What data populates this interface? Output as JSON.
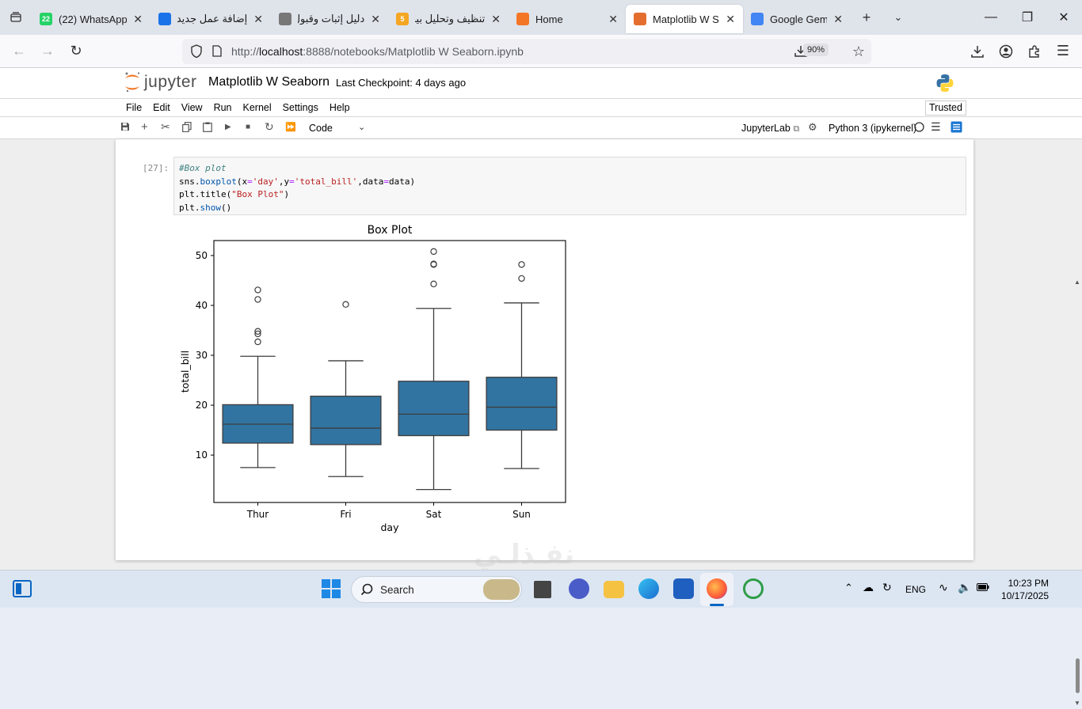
{
  "browser": {
    "tabs": [
      {
        "title": "(22) WhatsApp",
        "badge": "22",
        "icon": "whatsapp-icon",
        "color": "#25d366"
      },
      {
        "title": "إضافة عمل جديد |",
        "icon": "refresh-swirl-icon",
        "color": "#1a73e8"
      },
      {
        "title": "دليل إثبات وقبول المها",
        "icon": "generic-page-icon",
        "color": "#777777"
      },
      {
        "title": "تنظيف وتحليل بيا",
        "icon": "five-icon",
        "badge": "5",
        "color": "#f5a623"
      },
      {
        "title": "Home",
        "icon": "jupyter-spinner-icon",
        "color": "#f37626"
      },
      {
        "title": "Matplotlib W Seaborn",
        "icon": "notebook-icon",
        "color": "#e46e2e",
        "active": true
      },
      {
        "title": "Google Gemini",
        "icon": "gemini-icon",
        "color": "#4285f4"
      }
    ],
    "url_prefix": "http://",
    "url_host": "localhost",
    "url_rest": ":8888/notebooks/Matplotlib W Seaborn.ipynb",
    "zoom": "90%"
  },
  "jupyter": {
    "logo_text": "jupyter",
    "notebook_title": "Matplotlib W Seaborn",
    "checkpoint": "Last Checkpoint: 4 days ago",
    "menu": [
      "File",
      "Edit",
      "View",
      "Run",
      "Kernel",
      "Settings",
      "Help"
    ],
    "trusted": "Trusted",
    "cell_type": "Code",
    "jupyterlab_link": "JupyterLab",
    "kernel": "Python 3 (ipykernel)"
  },
  "cell": {
    "prompt": "[27]:",
    "lines": [
      "#Box plot",
      "sns.boxplot(x='day',y='total_bill',data=data)",
      "plt.title(\"Box Plot\")",
      "plt.show()"
    ]
  },
  "chart_data": {
    "type": "box",
    "title": "Box Plot",
    "xlabel": "day",
    "ylabel": "total_bill",
    "ylim": [
      0.5,
      53
    ],
    "yticks": [
      10,
      20,
      30,
      40,
      50
    ],
    "color": "#3274a1",
    "categories": [
      "Thur",
      "Fri",
      "Sat",
      "Sun"
    ],
    "boxes": [
      {
        "whislo": 7.5,
        "q1": 12.4,
        "med": 16.2,
        "q3": 20.1,
        "whishi": 29.8,
        "fliers": [
          32.7,
          34.3,
          34.8,
          41.2,
          43.1
        ]
      },
      {
        "whislo": 5.7,
        "q1": 12.1,
        "med": 15.4,
        "q3": 21.8,
        "whishi": 28.9,
        "fliers": [
          40.2
        ]
      },
      {
        "whislo": 3.1,
        "q1": 13.9,
        "med": 18.2,
        "q3": 24.8,
        "whishi": 39.4,
        "fliers": [
          44.3,
          48.2,
          48.3,
          50.8
        ]
      },
      {
        "whislo": 7.3,
        "q1": 15.0,
        "med": 19.6,
        "q3": 25.6,
        "whishi": 40.5,
        "fliers": [
          45.4,
          48.2
        ]
      }
    ]
  },
  "taskbar": {
    "search": "Search",
    "lang": "ENG",
    "time": "10:23 PM",
    "date": "10/17/2025"
  },
  "watermark": "نفـذلـي"
}
